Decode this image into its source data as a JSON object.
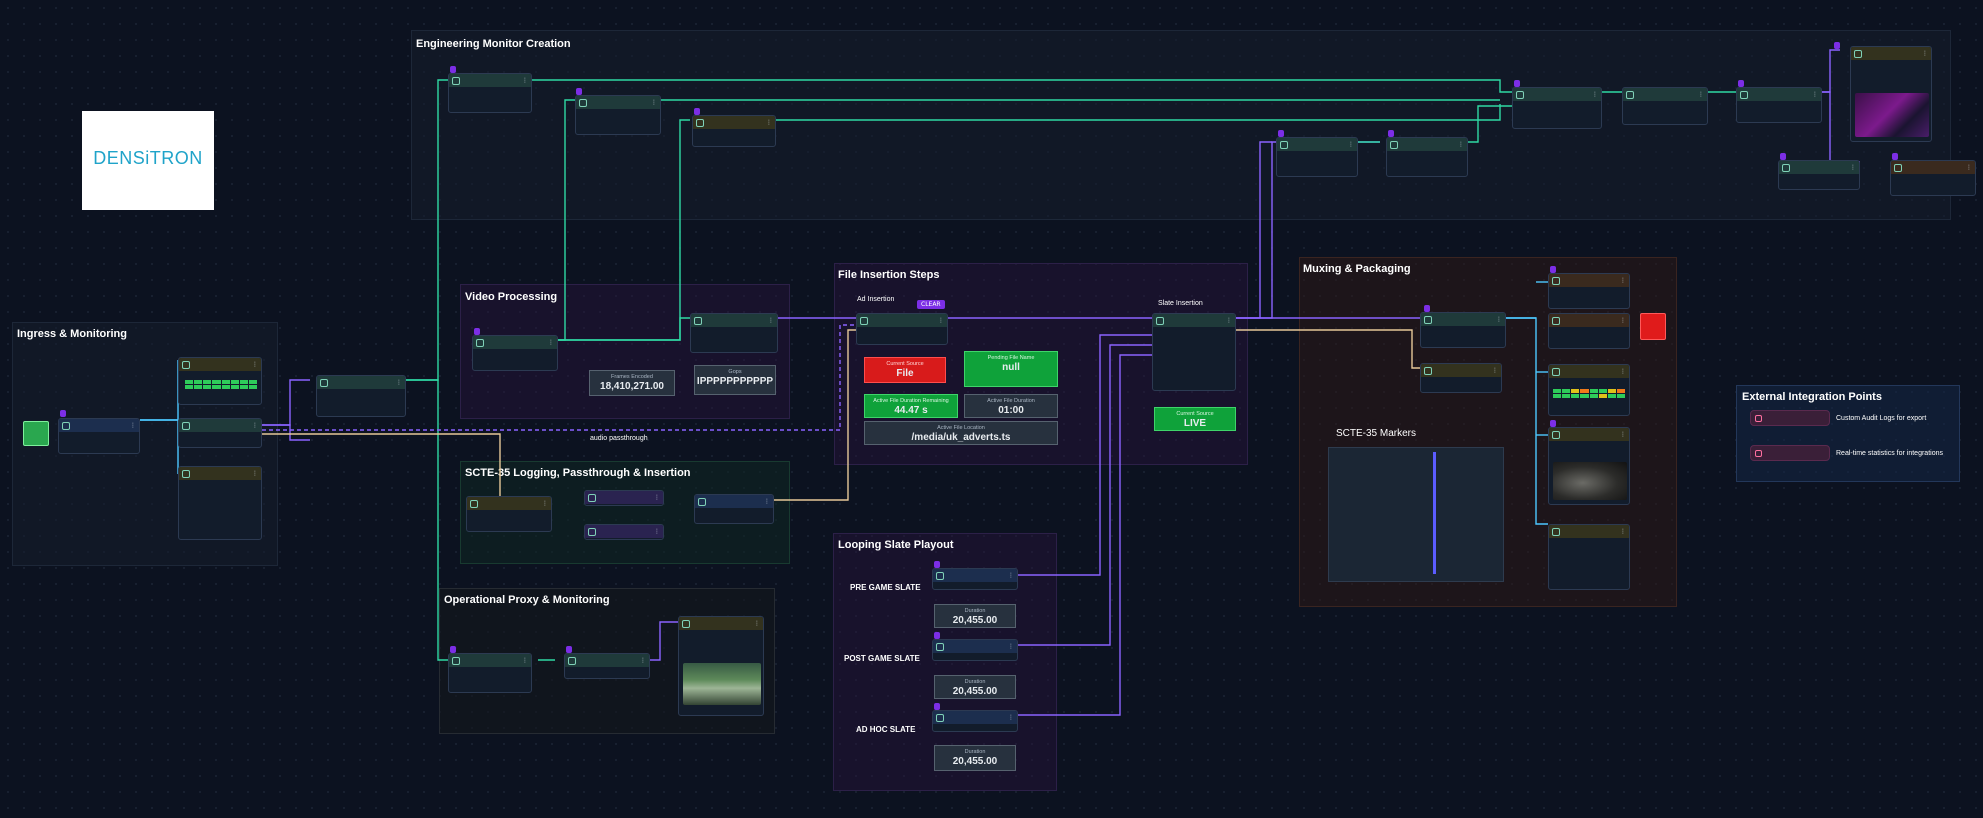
{
  "groups": {
    "engineering": "Engineering Monitor Creation",
    "ingress": "Ingress & Monitoring",
    "video": "Video Processing",
    "file_insertion": "File Insertion Steps",
    "scte35": "SCTE-35 Logging, Passthrough & Insertion",
    "proxy": "Operational Proxy & Monitoring",
    "looping": "Looping Slate Playout",
    "muxing": "Muxing & Packaging",
    "markers": "SCTE-35 Markers",
    "external": "External Integration Points"
  },
  "logo": "DENSiTRON",
  "subsections": {
    "ad_insertion": "Ad Insertion",
    "slate_insertion": "Slate Insertion",
    "clear_button": "CLEAR",
    "audio_passthrough": "audio passthrough"
  },
  "video_stats": {
    "frames_label": "Frames Encoded",
    "frames_value": "18,410,271.00",
    "gops_label": "Gops",
    "gops_value": "IPPPPPPPPPPP"
  },
  "file_insertion_stats": {
    "current_source_label": "Current Source",
    "current_source_value": "File",
    "pending_label": "Pending File Name",
    "pending_value": "null",
    "active_duration_label": "Active File Duration Remaining",
    "active_duration_value": "44.47 s",
    "active_file_duration_label": "Active File Duration",
    "active_file_duration_value": "01:00",
    "active_location_label": "Active File Location",
    "active_location_value": "/media/uk_adverts.ts"
  },
  "slate_source": {
    "label": "Current Source",
    "value": "LIVE"
  },
  "looping": {
    "pre_game": "PRE GAME SLATE",
    "post_game": "POST GAME SLATE",
    "ad_hoc": "AD HOC SLATE",
    "duration_label": "Duration",
    "duration_value": "20,455.00"
  },
  "external_items": [
    {
      "label": "Custom Audit Logs for export"
    },
    {
      "label": "Real-time statistics for integrations"
    }
  ],
  "status_colors": {
    "accent": "#2ecc71",
    "wire_green": "#2fd9a4",
    "wire_purple": "#8a63ff",
    "wire_tan": "#e6c898",
    "alert_red": "#e01b1b"
  }
}
